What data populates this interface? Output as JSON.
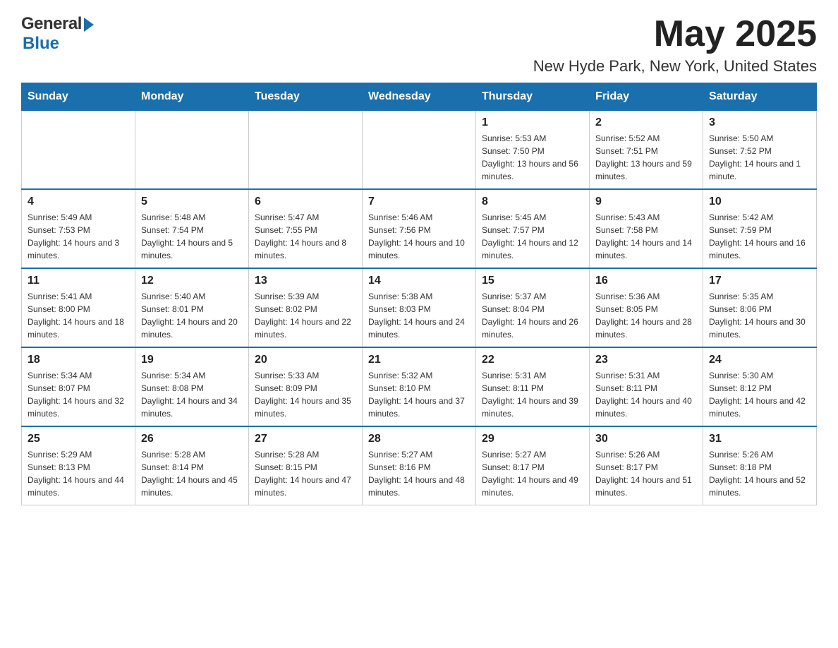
{
  "header": {
    "month_year": "May 2025",
    "location": "New Hyde Park, New York, United States",
    "logo_general": "General",
    "logo_blue": "Blue"
  },
  "days_of_week": [
    "Sunday",
    "Monday",
    "Tuesday",
    "Wednesday",
    "Thursday",
    "Friday",
    "Saturday"
  ],
  "weeks": [
    {
      "days": [
        {
          "num": "",
          "sunrise": "",
          "sunset": "",
          "daylight": ""
        },
        {
          "num": "",
          "sunrise": "",
          "sunset": "",
          "daylight": ""
        },
        {
          "num": "",
          "sunrise": "",
          "sunset": "",
          "daylight": ""
        },
        {
          "num": "",
          "sunrise": "",
          "sunset": "",
          "daylight": ""
        },
        {
          "num": "1",
          "sunrise": "Sunrise: 5:53 AM",
          "sunset": "Sunset: 7:50 PM",
          "daylight": "Daylight: 13 hours and 56 minutes."
        },
        {
          "num": "2",
          "sunrise": "Sunrise: 5:52 AM",
          "sunset": "Sunset: 7:51 PM",
          "daylight": "Daylight: 13 hours and 59 minutes."
        },
        {
          "num": "3",
          "sunrise": "Sunrise: 5:50 AM",
          "sunset": "Sunset: 7:52 PM",
          "daylight": "Daylight: 14 hours and 1 minute."
        }
      ]
    },
    {
      "days": [
        {
          "num": "4",
          "sunrise": "Sunrise: 5:49 AM",
          "sunset": "Sunset: 7:53 PM",
          "daylight": "Daylight: 14 hours and 3 minutes."
        },
        {
          "num": "5",
          "sunrise": "Sunrise: 5:48 AM",
          "sunset": "Sunset: 7:54 PM",
          "daylight": "Daylight: 14 hours and 5 minutes."
        },
        {
          "num": "6",
          "sunrise": "Sunrise: 5:47 AM",
          "sunset": "Sunset: 7:55 PM",
          "daylight": "Daylight: 14 hours and 8 minutes."
        },
        {
          "num": "7",
          "sunrise": "Sunrise: 5:46 AM",
          "sunset": "Sunset: 7:56 PM",
          "daylight": "Daylight: 14 hours and 10 minutes."
        },
        {
          "num": "8",
          "sunrise": "Sunrise: 5:45 AM",
          "sunset": "Sunset: 7:57 PM",
          "daylight": "Daylight: 14 hours and 12 minutes."
        },
        {
          "num": "9",
          "sunrise": "Sunrise: 5:43 AM",
          "sunset": "Sunset: 7:58 PM",
          "daylight": "Daylight: 14 hours and 14 minutes."
        },
        {
          "num": "10",
          "sunrise": "Sunrise: 5:42 AM",
          "sunset": "Sunset: 7:59 PM",
          "daylight": "Daylight: 14 hours and 16 minutes."
        }
      ]
    },
    {
      "days": [
        {
          "num": "11",
          "sunrise": "Sunrise: 5:41 AM",
          "sunset": "Sunset: 8:00 PM",
          "daylight": "Daylight: 14 hours and 18 minutes."
        },
        {
          "num": "12",
          "sunrise": "Sunrise: 5:40 AM",
          "sunset": "Sunset: 8:01 PM",
          "daylight": "Daylight: 14 hours and 20 minutes."
        },
        {
          "num": "13",
          "sunrise": "Sunrise: 5:39 AM",
          "sunset": "Sunset: 8:02 PM",
          "daylight": "Daylight: 14 hours and 22 minutes."
        },
        {
          "num": "14",
          "sunrise": "Sunrise: 5:38 AM",
          "sunset": "Sunset: 8:03 PM",
          "daylight": "Daylight: 14 hours and 24 minutes."
        },
        {
          "num": "15",
          "sunrise": "Sunrise: 5:37 AM",
          "sunset": "Sunset: 8:04 PM",
          "daylight": "Daylight: 14 hours and 26 minutes."
        },
        {
          "num": "16",
          "sunrise": "Sunrise: 5:36 AM",
          "sunset": "Sunset: 8:05 PM",
          "daylight": "Daylight: 14 hours and 28 minutes."
        },
        {
          "num": "17",
          "sunrise": "Sunrise: 5:35 AM",
          "sunset": "Sunset: 8:06 PM",
          "daylight": "Daylight: 14 hours and 30 minutes."
        }
      ]
    },
    {
      "days": [
        {
          "num": "18",
          "sunrise": "Sunrise: 5:34 AM",
          "sunset": "Sunset: 8:07 PM",
          "daylight": "Daylight: 14 hours and 32 minutes."
        },
        {
          "num": "19",
          "sunrise": "Sunrise: 5:34 AM",
          "sunset": "Sunset: 8:08 PM",
          "daylight": "Daylight: 14 hours and 34 minutes."
        },
        {
          "num": "20",
          "sunrise": "Sunrise: 5:33 AM",
          "sunset": "Sunset: 8:09 PM",
          "daylight": "Daylight: 14 hours and 35 minutes."
        },
        {
          "num": "21",
          "sunrise": "Sunrise: 5:32 AM",
          "sunset": "Sunset: 8:10 PM",
          "daylight": "Daylight: 14 hours and 37 minutes."
        },
        {
          "num": "22",
          "sunrise": "Sunrise: 5:31 AM",
          "sunset": "Sunset: 8:11 PM",
          "daylight": "Daylight: 14 hours and 39 minutes."
        },
        {
          "num": "23",
          "sunrise": "Sunrise: 5:31 AM",
          "sunset": "Sunset: 8:11 PM",
          "daylight": "Daylight: 14 hours and 40 minutes."
        },
        {
          "num": "24",
          "sunrise": "Sunrise: 5:30 AM",
          "sunset": "Sunset: 8:12 PM",
          "daylight": "Daylight: 14 hours and 42 minutes."
        }
      ]
    },
    {
      "days": [
        {
          "num": "25",
          "sunrise": "Sunrise: 5:29 AM",
          "sunset": "Sunset: 8:13 PM",
          "daylight": "Daylight: 14 hours and 44 minutes."
        },
        {
          "num": "26",
          "sunrise": "Sunrise: 5:28 AM",
          "sunset": "Sunset: 8:14 PM",
          "daylight": "Daylight: 14 hours and 45 minutes."
        },
        {
          "num": "27",
          "sunrise": "Sunrise: 5:28 AM",
          "sunset": "Sunset: 8:15 PM",
          "daylight": "Daylight: 14 hours and 47 minutes."
        },
        {
          "num": "28",
          "sunrise": "Sunrise: 5:27 AM",
          "sunset": "Sunset: 8:16 PM",
          "daylight": "Daylight: 14 hours and 48 minutes."
        },
        {
          "num": "29",
          "sunrise": "Sunrise: 5:27 AM",
          "sunset": "Sunset: 8:17 PM",
          "daylight": "Daylight: 14 hours and 49 minutes."
        },
        {
          "num": "30",
          "sunrise": "Sunrise: 5:26 AM",
          "sunset": "Sunset: 8:17 PM",
          "daylight": "Daylight: 14 hours and 51 minutes."
        },
        {
          "num": "31",
          "sunrise": "Sunrise: 5:26 AM",
          "sunset": "Sunset: 8:18 PM",
          "daylight": "Daylight: 14 hours and 52 minutes."
        }
      ]
    }
  ]
}
